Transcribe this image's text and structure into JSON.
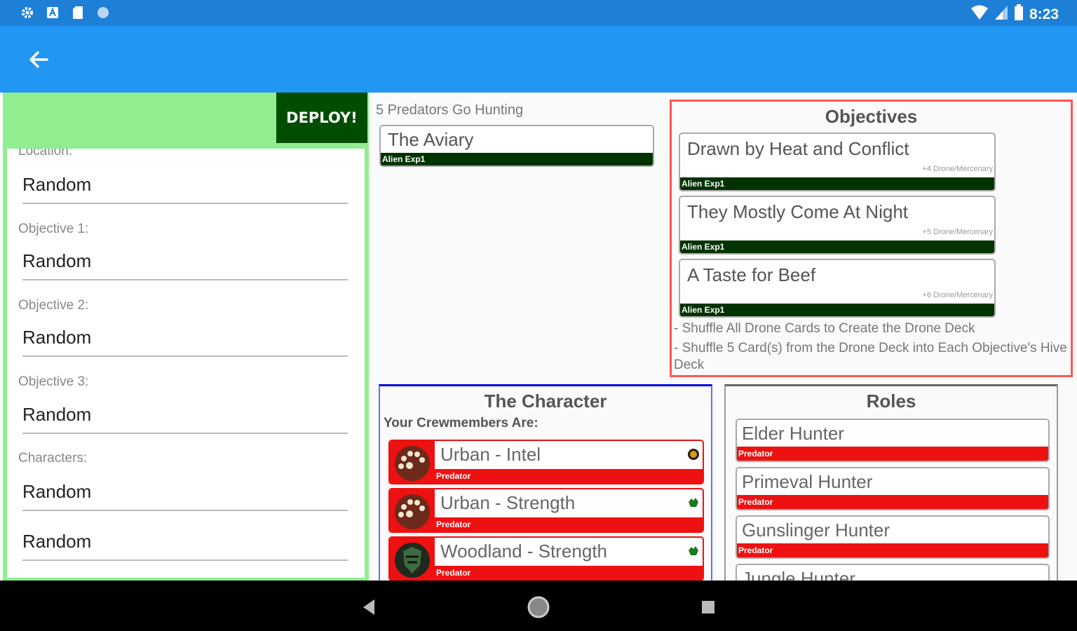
{
  "status_bar": {
    "left_icons": [
      "gear-icon",
      "a-icon",
      "sd-card-icon",
      "circle-icon"
    ],
    "right_icons": [
      "wifi-icon",
      "signal-icon",
      "battery-icon"
    ],
    "time": "8:23",
    "color": "#1e7fd6"
  },
  "app_bar": {
    "back_icon": "arrow-left-icon",
    "color": "#2196f3"
  },
  "setup": {
    "deploy_label": "DEPLOY!",
    "location_label": "Location:",
    "location_value": "Random",
    "objective1_label": "Objective 1:",
    "objective1_value": "Random",
    "objective2_label": "Objective 2:",
    "objective2_value": "Random",
    "objective3_label": "Objective 3:",
    "objective3_value": "Random",
    "characters_label": "Characters:",
    "character1_value": "Random",
    "character2_value": "Random"
  },
  "mission": {
    "label": "5 Predators Go Hunting",
    "location_card": {
      "title": "The Aviary",
      "tag": "Alien Exp1"
    }
  },
  "objectives": {
    "title": "Objectives",
    "cards": [
      {
        "title": "Drawn by Heat and Conflict",
        "subtitle": "+4 Drone/Mercenary",
        "tag": "Alien Exp1"
      },
      {
        "title": "They Mostly Come At Night",
        "subtitle": "+5 Drone/Mercenary",
        "tag": "Alien Exp1"
      },
      {
        "title": "A Taste for Beef",
        "subtitle": "+6 Drone/Mercenary",
        "tag": "Alien Exp1"
      }
    ],
    "instructions": [
      "- Shuffle All Drone Cards to Create the Drone Deck",
      "- Shuffle 5 Card(s) from the Drone Deck into Each Objective's Hive Deck"
    ]
  },
  "character": {
    "title": "The Character",
    "crew_label": "Your Crewmembers Are:",
    "members": [
      {
        "name": "Urban - Intel",
        "tag": "Predator",
        "avatar_icon": "urban-predator-icon",
        "trait_icon": "intel-token-icon"
      },
      {
        "name": "Urban - Strength",
        "tag": "Predator",
        "avatar_icon": "urban-predator-icon",
        "trait_icon": "strength-token-icon"
      },
      {
        "name": "Woodland - Strength",
        "tag": "Predator",
        "avatar_icon": "woodland-predator-icon",
        "trait_icon": "strength-token-icon"
      }
    ]
  },
  "roles": {
    "title": "Roles",
    "items": [
      {
        "name": "Elder Hunter",
        "tag": "Predator"
      },
      {
        "name": "Primeval Hunter",
        "tag": "Predator"
      },
      {
        "name": "Gunslinger Hunter",
        "tag": "Predator"
      },
      {
        "name": "Jungle Hunter",
        "tag": ""
      }
    ]
  },
  "nav_bar": {
    "icons": [
      "back-triangle-icon",
      "home-circle-icon",
      "recents-square-icon"
    ]
  },
  "colors": {
    "setup_panel": "#90ee90",
    "deploy_button": "#004d00",
    "location_tag": "#003300",
    "predator_tag": "#ee1111",
    "objectives_border": "#ff5555",
    "character_border": "#0000dd"
  }
}
